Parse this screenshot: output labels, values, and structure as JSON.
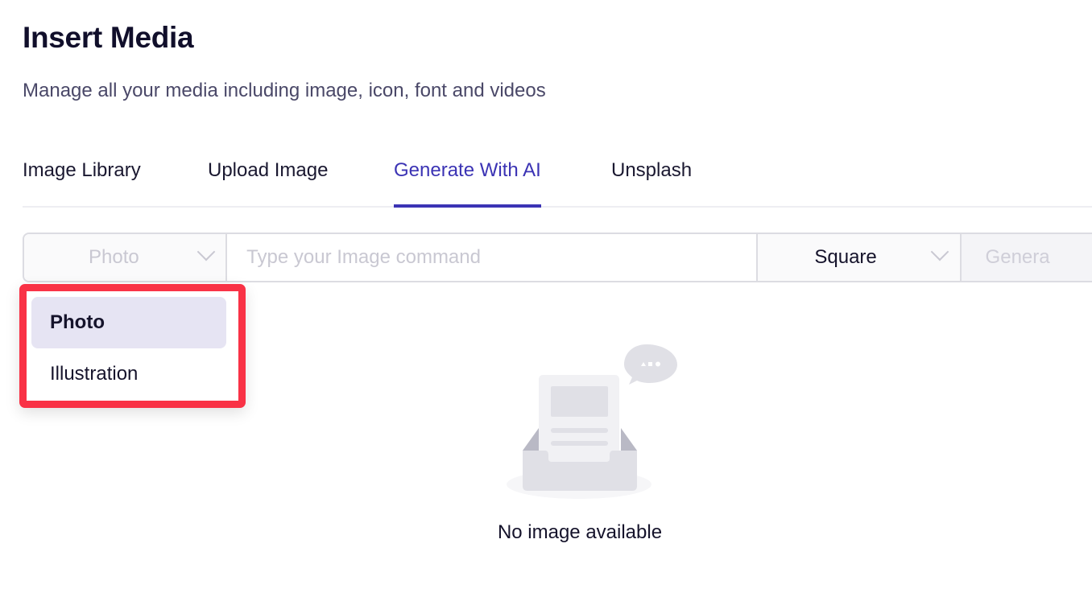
{
  "header": {
    "title": "Insert Media",
    "subtitle": "Manage all your media including image, icon, font and videos"
  },
  "tabs": [
    {
      "label": "Image Library",
      "active": false
    },
    {
      "label": "Upload Image",
      "active": false
    },
    {
      "label": "Generate With AI",
      "active": true
    },
    {
      "label": "Unsplash",
      "active": false
    }
  ],
  "generator": {
    "style_select": {
      "value": "Photo",
      "icon": "chevron-down-icon"
    },
    "prompt_input": {
      "value": "",
      "placeholder": "Type your Image command"
    },
    "ratio_select": {
      "value": "Square",
      "icon": "chevron-down-icon"
    },
    "generate_button": {
      "label": "Genera"
    }
  },
  "style_dropdown": {
    "options": [
      {
        "label": "Photo",
        "selected": true
      },
      {
        "label": "Illustration",
        "selected": false
      }
    ],
    "highlight_color": "#f93246"
  },
  "empty_state": {
    "icon": "empty-inbox-icon",
    "message": "No image available"
  },
  "colors": {
    "accent": "#3b33b4",
    "highlight_border": "#f93246",
    "selected_option_bg": "#e6e4f3"
  }
}
